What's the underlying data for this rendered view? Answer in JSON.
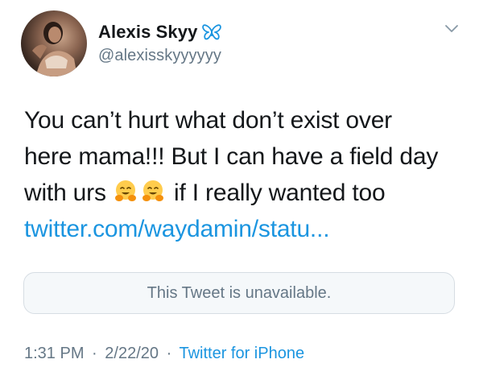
{
  "author": {
    "display_name": "Alexis Skyy",
    "handle": "@alexisskyyyyyy",
    "badge_icon": "butterfly-icon",
    "badge_color": "#1b95e0"
  },
  "tweet": {
    "line1": "You can’t hurt what don’t exist over",
    "line2": "here mama!!! But I can have a field day",
    "line3_start": "with urs",
    "line3_end": "if I really wanted too",
    "emoji_names": [
      "hugging-face-emoji",
      "hugging-face-emoji"
    ],
    "link_text": "twitter.com/waydamin/statu...",
    "link_color": "#1b95e0"
  },
  "quoted": {
    "unavailable_text": "This Tweet is unavailable."
  },
  "meta": {
    "time": "1:31 PM",
    "date": "2/22/20",
    "separator": "·",
    "source": "Twitter for iPhone"
  },
  "menu": {
    "icon": "chevron-down-icon"
  }
}
